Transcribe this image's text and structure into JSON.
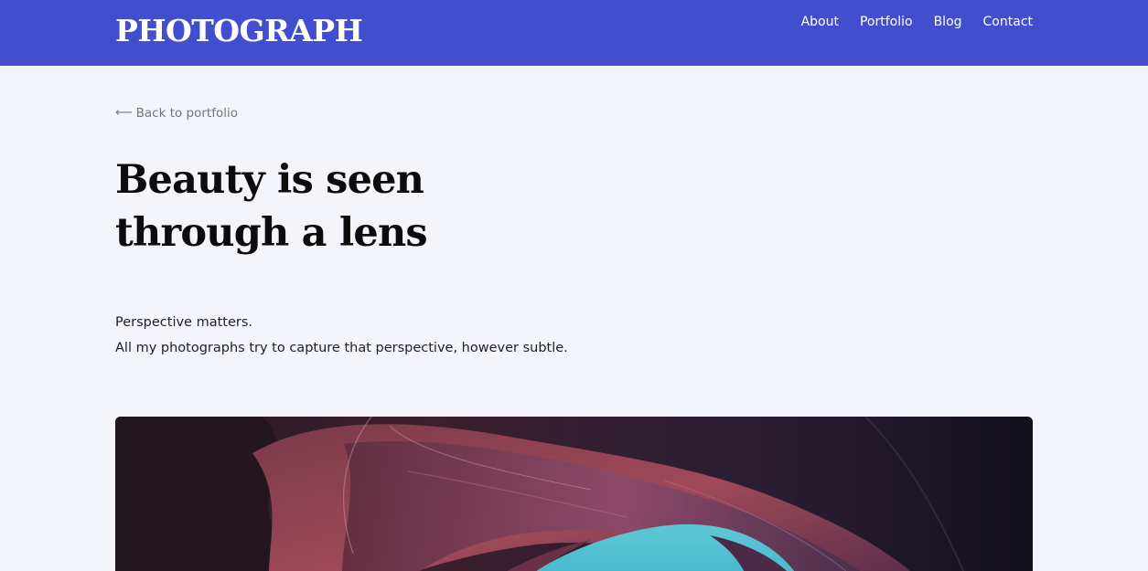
{
  "header": {
    "brand": "PHOTOGRAPH",
    "nav": [
      "About",
      "Portfolio",
      "Blog",
      "Contact"
    ],
    "background": "#434ecf"
  },
  "back_link": {
    "arrow": "⟵",
    "label": "Back to portfolio"
  },
  "main": {
    "title_line1": "Beauty is seen",
    "title_line2": "through a lens",
    "description": [
      "Perspective matters.",
      "All my photographs try to capture that perspective, however subtle."
    ]
  },
  "hero_image": {
    "icon": "canyon-photo"
  }
}
